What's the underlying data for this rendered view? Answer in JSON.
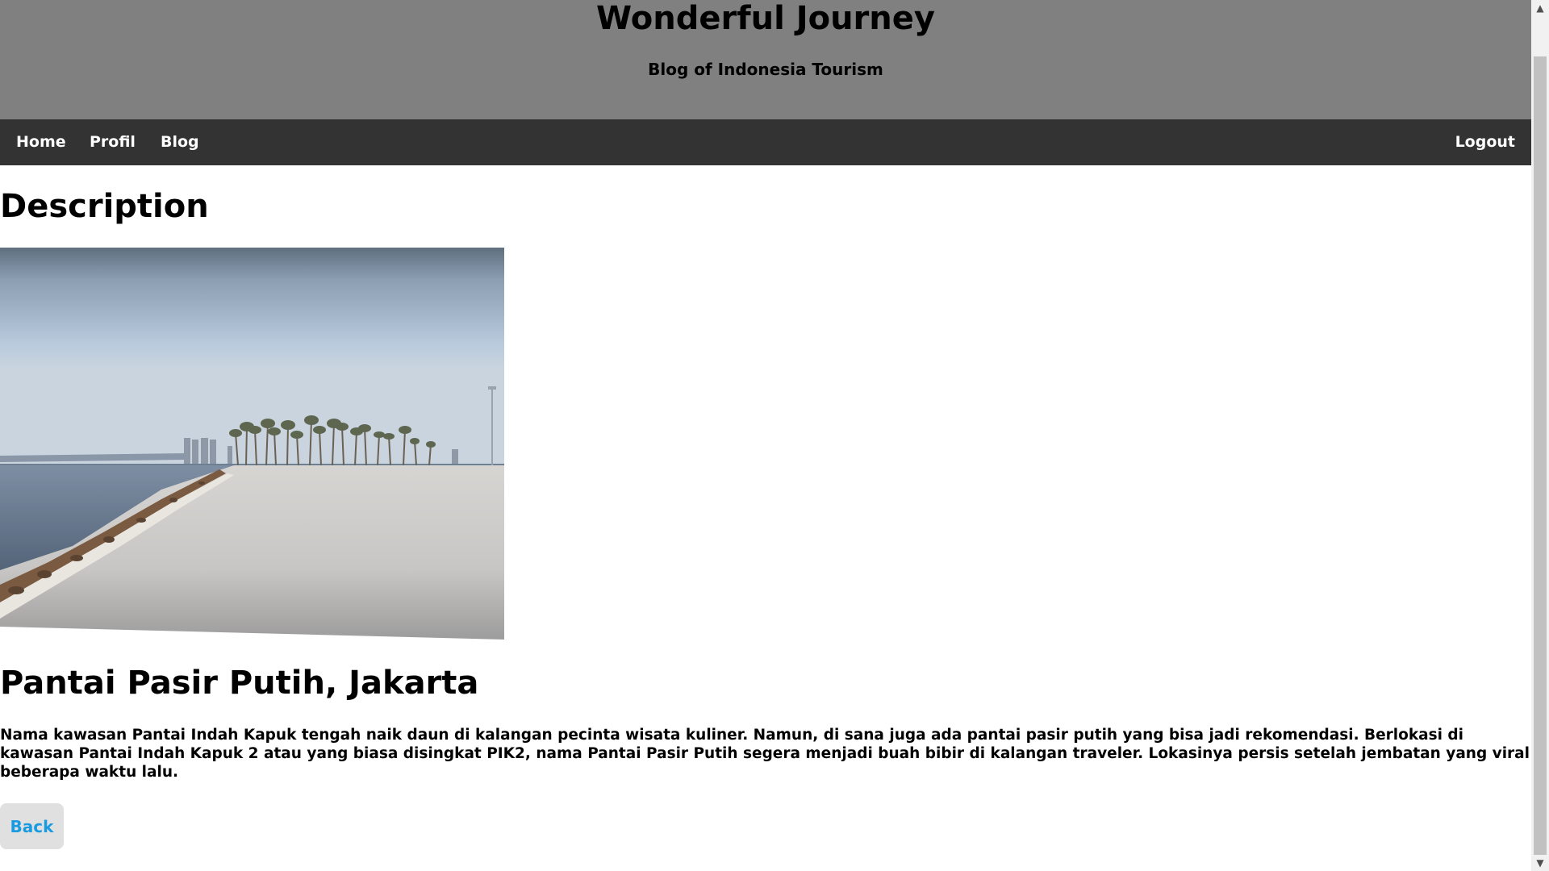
{
  "header": {
    "title": "Wonderful Journey",
    "tagline": "Blog of Indonesia Tourism"
  },
  "nav": {
    "home": "Home",
    "profil": "Profil",
    "blog": "Blog",
    "logout": "Logout"
  },
  "main": {
    "section_title": "Description",
    "image_alt": "Pantai Pasir Putih beach photo",
    "place_title": "Pantai Pasir Putih, Jakarta",
    "description": "Nama kawasan Pantai Indah Kapuk tengah naik daun di kalangan pecinta wisata kuliner. Namun, di sana juga ada pantai pasir putih yang bisa jadi rekomendasi. Berlokasi di kawasan Pantai Indah Kapuk 2 atau yang biasa disingkat PIK2, nama Pantai Pasir Putih segera menjadi buah bibir di kalangan traveler. Lokasinya persis setelah jembatan yang viral beberapa waktu lalu.",
    "back_label": "Back"
  },
  "colors": {
    "header_bg": "#808080",
    "nav_bg": "#333333",
    "link_blue": "#1a9be0",
    "button_bg": "#e0e0e0"
  },
  "icons": {
    "scroll_up": "chevron-up-icon",
    "scroll_down": "chevron-down-icon"
  }
}
